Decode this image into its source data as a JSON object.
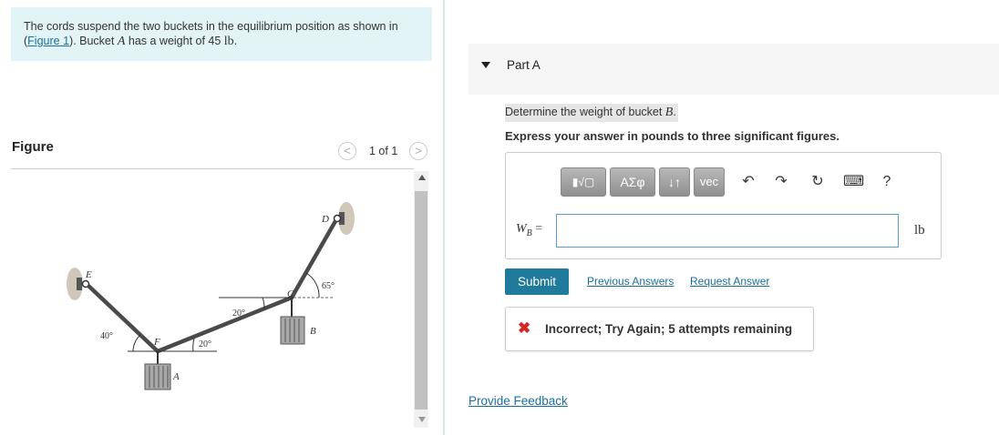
{
  "problem": {
    "line1": "The cords suspend the two buckets in the equilibrium position as shown in",
    "fig_link": "Figure 1",
    "open_paren": "(",
    "mid": "). Bucket ",
    "bucket_var": "A",
    "mid2": " has a weight of 45 ",
    "unit": "lb",
    "end": "."
  },
  "figure": {
    "title": "Figure",
    "pager": "1 of 1",
    "prev": "<",
    "next": ">",
    "labels": {
      "D": "D",
      "E": "E",
      "F": "F",
      "C": "C",
      "A": "A",
      "B": "B",
      "ang65": "65°",
      "ang20a": "20°",
      "ang40": "40°",
      "ang20b": "20°"
    }
  },
  "part": {
    "label": "Part A"
  },
  "question": {
    "text": "Determine the weight of bucket ",
    "var": "B",
    "end": ".",
    "instructions": "Express your answer in pounds to three significant figures."
  },
  "toolbar": {
    "templates": "▮√▢",
    "greek": "ΑΣφ",
    "arrows": "↓↑",
    "vec": "vec",
    "undo": "↶",
    "redo": "↷",
    "reset": "↻",
    "keyboard": "⌨",
    "help": "?"
  },
  "answer": {
    "var": "W",
    "sub": "B",
    "equals": " =",
    "value": "",
    "unit": "lb"
  },
  "actions": {
    "submit": "Submit",
    "previous_answers": "Previous Answers",
    "request_answer": "Request Answer"
  },
  "feedback": {
    "icon": "✖",
    "text": "Incorrect; Try Again; 5 attempts remaining"
  },
  "provide_feedback": "Provide Feedback"
}
